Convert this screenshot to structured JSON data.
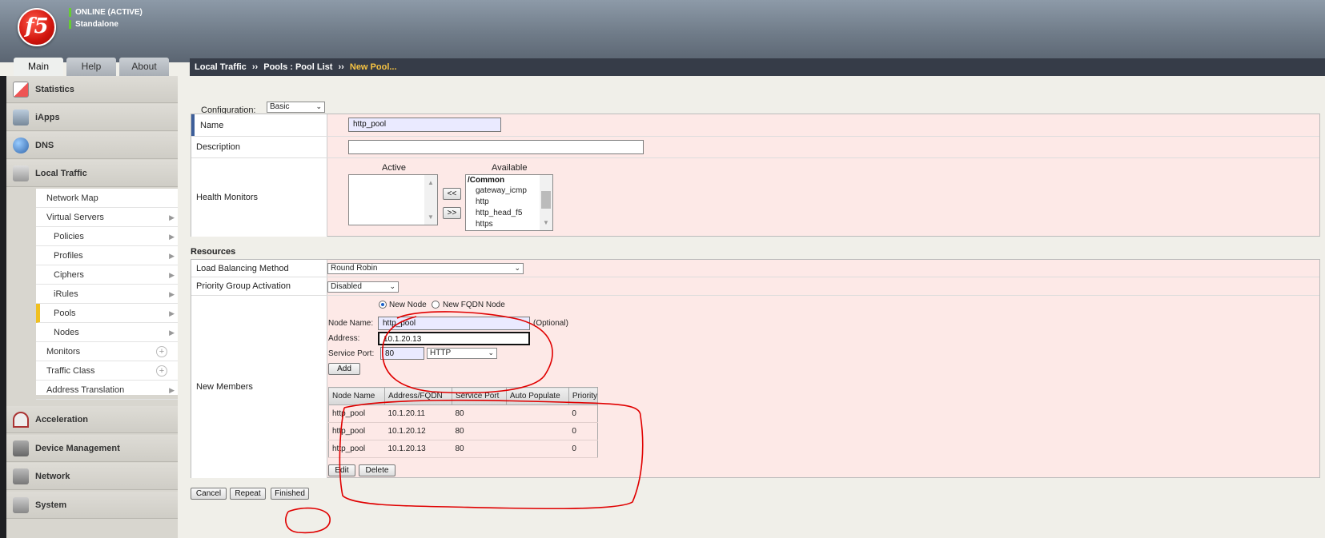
{
  "header": {
    "logo_text": "f5",
    "status": [
      "ONLINE (ACTIVE)",
      "Standalone"
    ]
  },
  "tabs": [
    "Main",
    "Help",
    "About"
  ],
  "breadcrumb": {
    "part1": "Local Traffic",
    "sep": "››",
    "part2": "Pools : Pool List",
    "current": "New Pool..."
  },
  "sidebar": {
    "statistics": "Statistics",
    "iapps": "iApps",
    "dns": "DNS",
    "local_traffic": "Local Traffic",
    "sub": [
      "Network Map",
      "Virtual Servers",
      "Policies",
      "Profiles",
      "Ciphers",
      "iRules",
      "Pools",
      "Nodes",
      "Monitors",
      "Traffic Class",
      "Address Translation"
    ],
    "acceleration": "Acceleration",
    "device_management": "Device Management",
    "network": "Network",
    "system": "System"
  },
  "config": {
    "label": "Configuration:",
    "value": "Basic"
  },
  "general": {
    "name_label": "Name",
    "name_value": "http_pool",
    "description_label": "Description",
    "description_value": "",
    "health_label": "Health Monitors",
    "active_label": "Active",
    "available_label": "Available",
    "move_left": "<<",
    "move_right": ">>",
    "available_items": [
      "/Common",
      "gateway_icmp",
      "http",
      "http_head_f5",
      "https"
    ]
  },
  "resources": {
    "title": "Resources",
    "lb_label": "Load Balancing Method",
    "lb_value": "Round Robin",
    "pga_label": "Priority Group Activation",
    "pga_value": "Disabled",
    "new_members_label": "New Members",
    "radio_new_node": "New Node",
    "radio_fqdn": "New FQDN Node",
    "node_name_label": "Node Name:",
    "node_name_value": "http_pool",
    "optional": "(Optional)",
    "address_label": "Address:",
    "address_value": "10.1.20.13",
    "service_port_label": "Service Port:",
    "service_port_value": "80",
    "service_value": "HTTP",
    "add_button": "Add",
    "columns": [
      "Node Name",
      "Address/FQDN",
      "Service Port",
      "Auto Populate",
      "Priority"
    ],
    "members": [
      [
        "http_pool",
        "10.1.20.11",
        "80",
        "",
        "0"
      ],
      [
        "http_pool",
        "10.1.20.12",
        "80",
        "",
        "0"
      ],
      [
        "http_pool",
        "10.1.20.13",
        "80",
        "",
        "0"
      ]
    ],
    "edit_button": "Edit",
    "delete_button": "Delete"
  },
  "footer": {
    "cancel": "Cancel",
    "repeat": "Repeat",
    "finished": "Finished"
  },
  "colors": {
    "form_bg": "#fde9e7",
    "breadcrumb_bg": "#363c48",
    "breadcrumb_current": "#f6c342",
    "annotation": "#e00000"
  }
}
